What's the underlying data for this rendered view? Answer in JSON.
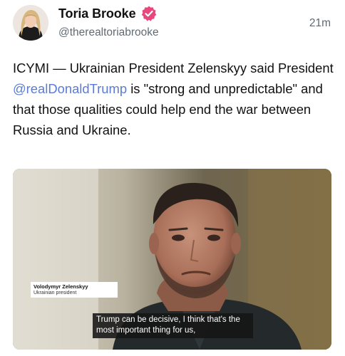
{
  "post": {
    "author": {
      "display_name": "Toria Brooke",
      "handle": "@therealtoriabrooke",
      "verified_icon": "verified-badge-icon",
      "avatar": "profile-avatar"
    },
    "timestamp": "21m",
    "text_before": "ICYMI — Ukrainian President Zelenskyy said President ",
    "mention": "@realDonaldTrump",
    "text_after": " is \"strong and unpredictable\" and that those qualities could help end the war between Russia and Ukraine."
  },
  "media": {
    "lower_third": {
      "name": "Volodymyr Zelenskyy",
      "title": "Ukrainian president"
    },
    "subtitle": "Trump can be decisive, I think that's the most important thing for us,"
  },
  "colors": {
    "mention": "#5b7bd5",
    "verified_badge": "#e8467c",
    "secondary_text": "#5f6a74"
  }
}
